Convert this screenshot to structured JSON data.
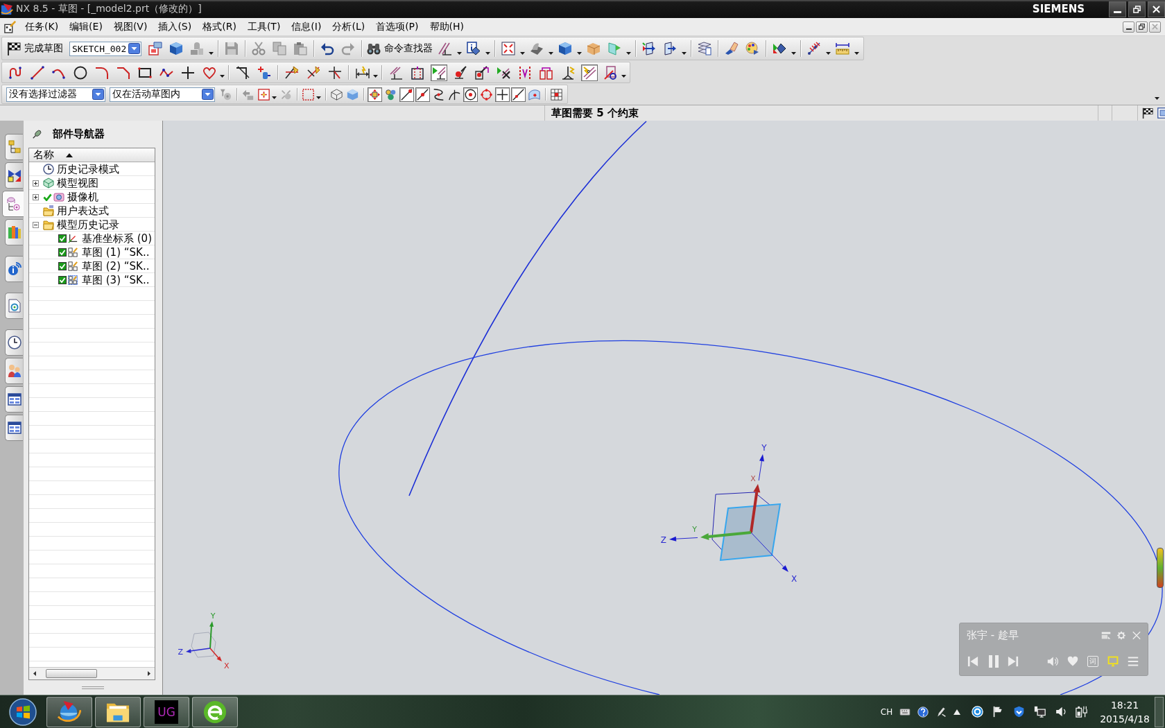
{
  "window": {
    "title": "NX 8.5 - 草图 - [_model2.prt（修改的）]",
    "brand": "SIEMENS"
  },
  "menu": [
    "任务(K)",
    "编辑(E)",
    "视图(V)",
    "插入(S)",
    "格式(R)",
    "工具(T)",
    "信息(I)",
    "分析(L)",
    "首选项(P)",
    "帮助(H)"
  ],
  "sketch_toolbar": {
    "finish_label": "完成草图",
    "sketch_name": "SKETCH_002",
    "command_finder": "命令查找器"
  },
  "sketch_tools": {
    "constraints": [
      {
        "pressed": false
      },
      {
        "pressed": false
      },
      {
        "pressed": true
      },
      {
        "pressed": false
      },
      {
        "pressed": false
      },
      {
        "pressed": false
      },
      {
        "pressed": false
      },
      {
        "pressed": false
      },
      {
        "pressed": false
      },
      {
        "pressed": true
      },
      {
        "pressed": false
      }
    ]
  },
  "selection_bar": {
    "type_filter": "没有选择过滤器",
    "scope": "仅在活动草图内",
    "snap_points": [
      {
        "pressed": true
      },
      {
        "pressed": false
      },
      {
        "pressed": true
      },
      {
        "pressed": true
      },
      {
        "pressed": false
      },
      {
        "pressed": false
      },
      {
        "pressed": true
      },
      {
        "pressed": false
      },
      {
        "pressed": true
      },
      {
        "pressed": true
      },
      {
        "pressed": false
      }
    ]
  },
  "status_line": {
    "message": "草图需要 5 个约束"
  },
  "resource_bar": {
    "tabs": [
      {
        "kind": "assembly",
        "selected": false
      },
      {
        "kind": "constraint",
        "selected": false
      },
      {
        "kind": "part",
        "selected": true
      },
      {
        "kind": "library",
        "selected": false
      },
      {
        "kind": "info",
        "selected": false
      },
      {
        "kind": "web",
        "selected": false
      },
      {
        "kind": "history",
        "selected": false
      },
      {
        "kind": "roles",
        "selected": false
      },
      {
        "kind": "panels",
        "selected": false
      },
      {
        "kind": "panels",
        "selected": false
      }
    ]
  },
  "part_navigator": {
    "title": "部件导航器",
    "column": "名称",
    "items": [
      {
        "label": "历史记录模式",
        "kind": "history",
        "checked": false
      },
      {
        "label": "模型视图",
        "kind": "views",
        "checked": false,
        "expanded": false
      },
      {
        "label": "摄像机",
        "kind": "cameras",
        "checked": true,
        "expanded": false
      },
      {
        "label": "用户表达式",
        "kind": "expressions",
        "checked": false
      },
      {
        "label": "模型历史记录",
        "kind": "folder",
        "checked": false,
        "expanded": true,
        "children": [
          {
            "label": "基准坐标系 (0)",
            "kind": "datum",
            "checked": true
          },
          {
            "label": "草图 (1) “SK..",
            "kind": "sketch",
            "checked": true
          },
          {
            "label": "草图 (2) “SK..",
            "kind": "sketch",
            "checked": true
          },
          {
            "label": "草图 (3) “SK..",
            "kind": "active",
            "checked": true
          }
        ]
      }
    ]
  },
  "graphics": {
    "datum_labels": [
      "Y",
      "X",
      "Z",
      "X",
      "Y"
    ],
    "triad_labels": [
      "Y",
      "Z",
      "X"
    ]
  },
  "music_player": {
    "song": "张宇 - 趁早",
    "playing": true,
    "lyrics_button": "词"
  },
  "taskbar": {
    "apps": [
      {
        "kind": "nx"
      },
      {
        "kind": "explorer"
      },
      {
        "kind": "ug",
        "label": "UG"
      },
      {
        "kind": "browser"
      }
    ],
    "language": "CH",
    "time": "18:21",
    "date": "2015/4/18"
  }
}
